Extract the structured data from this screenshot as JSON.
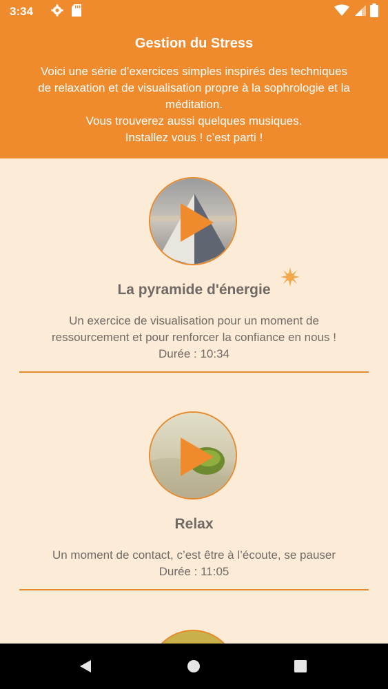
{
  "status_bar": {
    "time": "3:34",
    "icons": [
      "settings-icon",
      "sd-card-icon",
      "wifi-icon",
      "signal-icon",
      "battery-icon"
    ]
  },
  "header": {
    "title": "Gestion du Stress",
    "description_lines": [
      "Voici une série d’exercices simples inspirés des techniques",
      "de relaxation et de visualisation propre à la sophrologie et la",
      "méditation.",
      "Vous trouverez aussi quelques musiques.",
      "Installez vous ! c’est parti !"
    ]
  },
  "exercises": [
    {
      "title": "La pyramide d'énergie",
      "description_lines": [
        "Un exercice de visualisation pour un moment de",
        "ressourcement et pour renforcer la confiance en nous !"
      ],
      "duration": "Durée : 10:34",
      "image": "pyramid-image"
    },
    {
      "title": "Relax",
      "description_lines": [
        "Un moment de contact, c’est être à l’écoute, se pauser"
      ],
      "duration": "Durée : 11:05",
      "image": "leaf-on-sand-image"
    }
  ],
  "colors": {
    "accent": "#ef8b2c",
    "background": "#fcebd6",
    "text": "#6f6a66"
  },
  "nav_bar": {
    "buttons": [
      "back-icon",
      "home-icon",
      "recents-icon"
    ]
  }
}
